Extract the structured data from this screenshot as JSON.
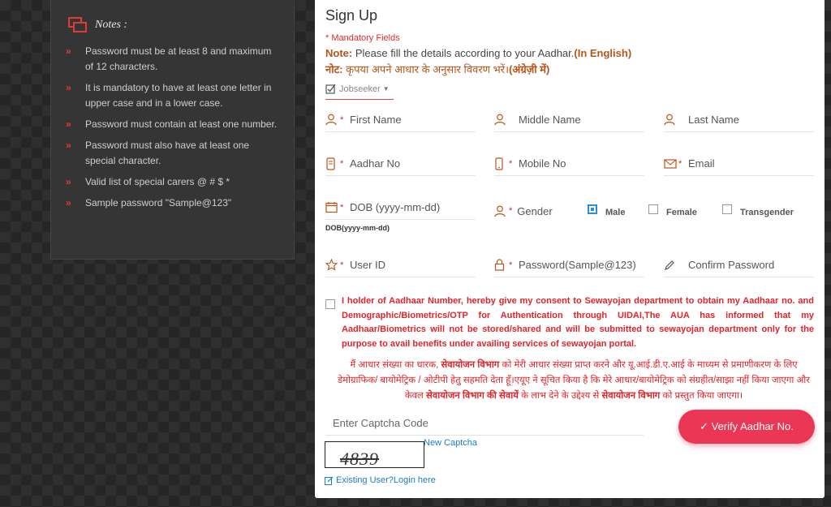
{
  "notes": {
    "title": "Notes :",
    "items": [
      "Password must be at least 8 and maximum of 12 characters.",
      "It is mandatory to have at least one letter in upper case and in a lower case.",
      "Password must contain at least one number.",
      "Password must also have at least one special character.",
      "Valid list of special carers @ # $ *",
      "Sample password \"Sample@123\""
    ]
  },
  "signup": {
    "title": "Sign Up",
    "mandatory": "* Mandatory Fields",
    "note_label": "Note:",
    "note_text": " Please fill the details according to your Aadhar.",
    "note_in_english": "(In English)",
    "note_hindi_prefix": "नोट:",
    "note_hindi_text": " कृपया अपने आधार के अनुसार विवरण भरें।",
    "note_hindi_bold": "(अंग्रेज़ी में)",
    "user_type": "Jobseeker",
    "fields": {
      "first_name": "First Name",
      "middle_name": "Middle Name",
      "last_name": "Last Name",
      "aadhar_no": "Aadhar No",
      "mobile_no": "Mobile No",
      "email": "Email",
      "dob": "DOB (yyyy-mm-dd)",
      "user_id": "User ID",
      "password": "Password(Sample@123)",
      "confirm_password": "Confirm Password"
    },
    "dob_hint": "DOB(yyyy-mm-dd)",
    "gender_label": "Gender",
    "gender_options": [
      "Male",
      "Female",
      "Transgender"
    ],
    "gender_selected": "Male",
    "consent_en": "I holder of Aadhaar Number, hereby give my consent to Sewayojan department to obtain my Aadhaar no. and Demographic/Biometrics/OTP for Authentication through UIDAI,The AUA has informed that my Aadhaar/Biometrics will not be stored/shared and will be submitted to sewayojan department only for the purpose to avail benefits under availing services of sewayojan portal.",
    "consent_hi_1": "मैं आधार संख्या का धारक, ",
    "consent_hi_b1": "सेवायोजन विभाग",
    "consent_hi_2": " को मेरी आधार संख्या प्राप्त करने और यू.आई.डी.ए.आई के माध्यम से प्रमाणीकरण के लिए डेमोग्राफिक/ बायोमेट्रिक / ओटीपी हेतु सहमति देता हूँ।एयूए ने सूचित किया है कि मेरे आधार/बायोमेट्रिक को संग्रहीत/साझा नहीं किया जाएगा और केवल ",
    "consent_hi_b2": "सेवायोजन विभाग की सेवायें",
    "consent_hi_3": " के लाभ देने के उद्देश्य से ",
    "consent_hi_b3": "सेवायोजन विभाग",
    "consent_hi_4": " को प्रस्तुत किया जाएगा।",
    "captcha_placeholder": "Enter Captcha Code",
    "captcha_value": "4839",
    "new_captcha": "New Captcha",
    "verify_button": "✓ Verify Aadhar No.",
    "existing_user": "Existing User?Login here"
  },
  "colors": {
    "accent_red": "#e0242a",
    "button_pink": "#ec3656",
    "link_blue": "#1a7bd0",
    "note_orange": "#b4551a",
    "radio_blue": "#2a8ed8"
  }
}
